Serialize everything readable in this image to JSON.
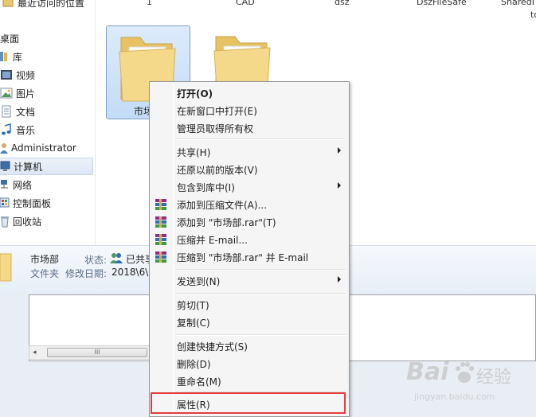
{
  "nav_pane": {
    "items": [
      {
        "label": "最近访问的位置",
        "icon": "recent-places-icon"
      },
      {
        "label": "桌面",
        "icon": "desktop-icon"
      },
      {
        "label": "库",
        "icon": "library-icon"
      },
      {
        "label": "视频",
        "icon": "video-icon"
      },
      {
        "label": "图片",
        "icon": "pictures-icon"
      },
      {
        "label": "文档",
        "icon": "documents-icon"
      },
      {
        "label": "音乐",
        "icon": "music-icon"
      },
      {
        "label": "Administrator",
        "icon": "user-icon"
      },
      {
        "label": "计算机",
        "icon": "computer-icon"
      },
      {
        "label": "网络",
        "icon": "network-icon"
      },
      {
        "label": "控制面板",
        "icon": "control-panel-icon"
      },
      {
        "label": "回收站",
        "icon": "recycle-bin-icon"
      }
    ]
  },
  "file_area": {
    "column_labels": [
      "1",
      "CAD",
      "dsz",
      "DszFileSafe",
      "SharedI",
      "to"
    ],
    "folders": [
      {
        "label": "市场部",
        "selected": true
      },
      {
        "label": "",
        "selected": false
      }
    ]
  },
  "details_pane": {
    "name": "市场部",
    "status_label": "状态:",
    "status_value": "已共享",
    "type": "文件夹",
    "modified_label": "修改日期:",
    "modified_value": "2018\\6\\1"
  },
  "scrollbar": {
    "thumb_grip": "III"
  },
  "context_menu": {
    "items": [
      {
        "label": "打开(O)",
        "bold": true,
        "icon": null,
        "submenu": false
      },
      {
        "label": "在新窗口中打开(E)",
        "bold": false,
        "icon": null,
        "submenu": false
      },
      {
        "label": "管理员取得所有权",
        "bold": false,
        "icon": null,
        "submenu": false
      },
      {
        "separator": true
      },
      {
        "label": "共享(H)",
        "bold": false,
        "icon": null,
        "submenu": true
      },
      {
        "label": "还原以前的版本(V)",
        "bold": false,
        "icon": null,
        "submenu": false
      },
      {
        "label": "包含到库中(I)",
        "bold": false,
        "icon": null,
        "submenu": true
      },
      {
        "label": "添加到压缩文件(A)...",
        "bold": false,
        "icon": "winrar-icon",
        "submenu": false
      },
      {
        "label": "添加到 \"市场部.rar\"(T)",
        "bold": false,
        "icon": "winrar-icon",
        "submenu": false
      },
      {
        "label": "压缩并 E-mail...",
        "bold": false,
        "icon": "winrar-icon",
        "submenu": false
      },
      {
        "label": "压缩到 \"市场部.rar\" 并 E-mail",
        "bold": false,
        "icon": "winrar-icon",
        "submenu": false
      },
      {
        "separator": true
      },
      {
        "label": "发送到(N)",
        "bold": false,
        "icon": null,
        "submenu": true
      },
      {
        "separator": true
      },
      {
        "label": "剪切(T)",
        "bold": false,
        "icon": null,
        "submenu": false
      },
      {
        "label": "复制(C)",
        "bold": false,
        "icon": null,
        "submenu": false
      },
      {
        "separator": true
      },
      {
        "label": "创建快捷方式(S)",
        "bold": false,
        "icon": null,
        "submenu": false
      },
      {
        "label": "删除(D)",
        "bold": false,
        "icon": null,
        "submenu": false
      },
      {
        "label": "重命名(M)",
        "bold": false,
        "icon": null,
        "submenu": false
      },
      {
        "separator": true
      },
      {
        "label": "属性(R)",
        "bold": false,
        "icon": null,
        "submenu": false,
        "highlighted": true
      }
    ]
  },
  "watermark": {
    "brand": "Bai",
    "brand_suffix": "经验",
    "url": "jingyan.baidu.com"
  },
  "colors": {
    "highlight_border": "#e53b3b",
    "selection_bg": "#dcebfc",
    "folder_yellow": "#f3d37a"
  }
}
